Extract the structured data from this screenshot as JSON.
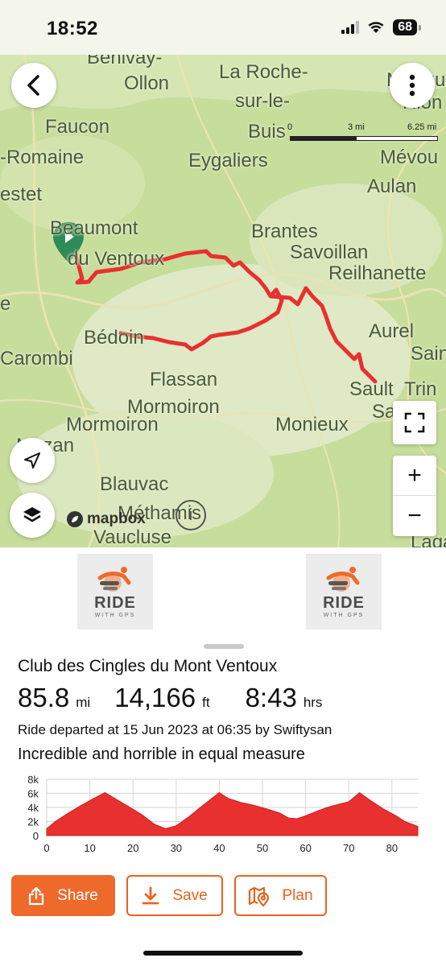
{
  "status": {
    "time": "18:52",
    "battery": "68"
  },
  "map": {
    "places": [
      "Benivay-",
      "Ollon",
      "La Roche-",
      "sur-le-",
      "Buis",
      "Mérigu",
      "Rion",
      "Faucon",
      "-Romaine",
      "Eygaliers",
      "Mévou",
      "Aulan",
      "estet",
      "Beaumont",
      "du Ventoux",
      "Brantes",
      "Savoillan",
      "Reilhanette",
      "e",
      "Aurel",
      "Sain",
      "Bédoin",
      "Carombi",
      "Flassan",
      "Sault",
      "Trin",
      "Sa",
      "Mormoiron",
      "Mormoiron",
      "Monieux",
      "Mazan",
      "Blauvac",
      "Méthamis",
      "Vaucluse",
      "Lagar"
    ],
    "scale": {
      "l0": "0",
      "l1": "3 mi",
      "l2": "6.25 mi"
    },
    "attribution": "mapbox",
    "info": "i",
    "icons": {
      "back": "chevron-left-icon",
      "more": "vertical-dots-icon",
      "start": "play-icon",
      "fullscreen": "fullscreen-icon",
      "zoom_in": "+",
      "zoom_out": "−",
      "locate": "location-arrow-icon",
      "layers": "layers-icon"
    },
    "route_color": "#e8302f",
    "start_marker_color": "#2e8b57"
  },
  "photos": [
    {
      "logo": "RIDE",
      "sub": "WITH GPS"
    },
    {
      "logo": "RIDE",
      "sub": "WITH GPS"
    }
  ],
  "ride": {
    "title": "Club des Cingles du Mont Ventoux",
    "distance": "85.8",
    "distance_unit": "mi",
    "elevation": "14,166",
    "elevation_unit": "ft",
    "duration": "8:43",
    "duration_unit": "hrs",
    "departed": "Ride departed at 15 Jun 2023 at 06:35 by Swiftysan",
    "description": "Incredible and horrible in equal measure"
  },
  "chart_data": {
    "type": "area",
    "title": "",
    "xlabel": "",
    "ylabel": "",
    "x_ticks": [
      "0",
      "10",
      "20",
      "30",
      "40",
      "50",
      "60",
      "70",
      "80"
    ],
    "y_ticks": [
      "0",
      "2k",
      "4k",
      "6k",
      "8k"
    ],
    "xlim": [
      0,
      86
    ],
    "ylim": [
      0,
      8000
    ],
    "grid": true,
    "color": "#e8302f",
    "series": [
      {
        "x": [
          0,
          2,
          5,
          8,
          11,
          13.5,
          16,
          19,
          22,
          25,
          27.5,
          30,
          33,
          36,
          38.5,
          40,
          42,
          45,
          48,
          51,
          54,
          56,
          58,
          60,
          62,
          65,
          68,
          70,
          72.5,
          75,
          78,
          81,
          83,
          86
        ],
        "y": [
          1000,
          2000,
          3200,
          4300,
          5300,
          6100,
          5200,
          4100,
          3000,
          1600,
          1000,
          1400,
          2700,
          4200,
          5400,
          6100,
          5300,
          4700,
          4300,
          3800,
          3200,
          2500,
          2400,
          2800,
          3300,
          4000,
          4500,
          4800,
          6100,
          5000,
          3800,
          2800,
          2000,
          1300
        ]
      }
    ]
  },
  "actions": {
    "share": "Share",
    "save": "Save",
    "plan": "Plan",
    "share_icon": "share-icon",
    "save_icon": "download-icon",
    "plan_icon": "map-pin-icon"
  },
  "colors": {
    "accent": "#ee6a2b"
  }
}
